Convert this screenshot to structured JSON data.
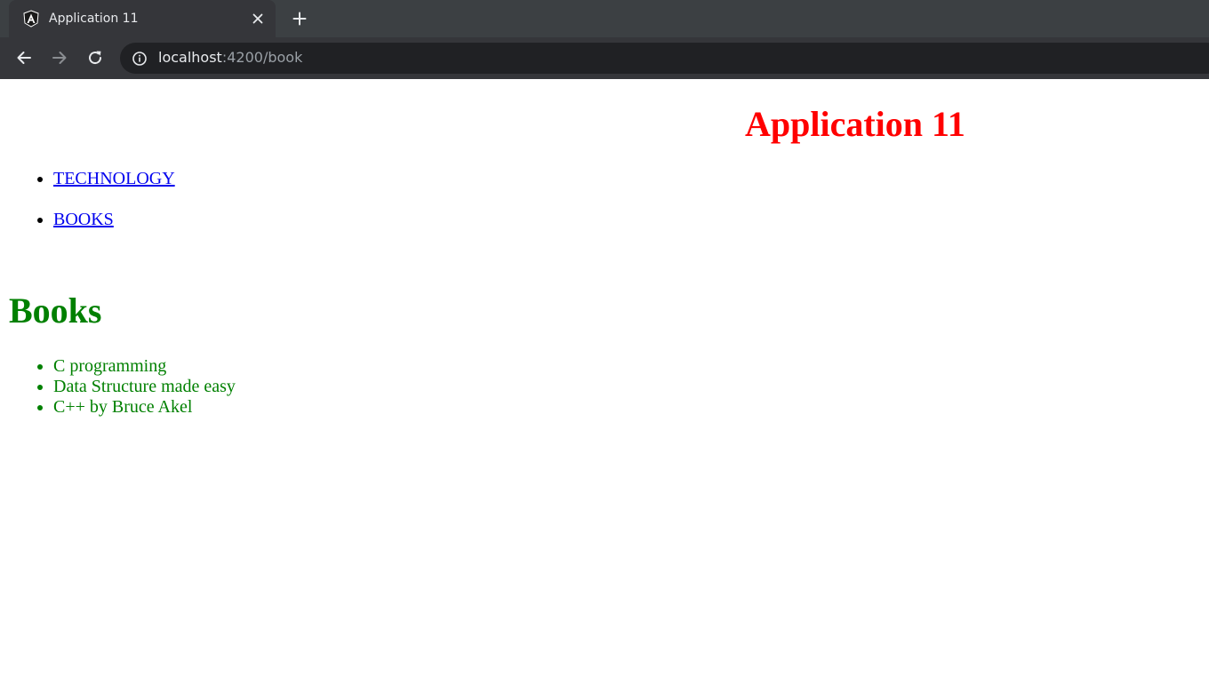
{
  "browser": {
    "tab_title": "Application 11",
    "url_host": "localhost",
    "url_rest": ":4200/book",
    "favicon": "angular-icon",
    "colors": {
      "tabstrip": "#3c4043",
      "toolbar": "#35363a",
      "omnibox": "#202124"
    }
  },
  "app": {
    "title": "Application 11",
    "title_color": "#ff0000",
    "nav": [
      {
        "label": "TECHNOLOGY"
      },
      {
        "label": "BOOKS"
      }
    ]
  },
  "books": {
    "heading": "Books",
    "color": "#008000",
    "items": [
      "C programming",
      "Data Structure made easy",
      "C++ by Bruce Akel"
    ]
  }
}
